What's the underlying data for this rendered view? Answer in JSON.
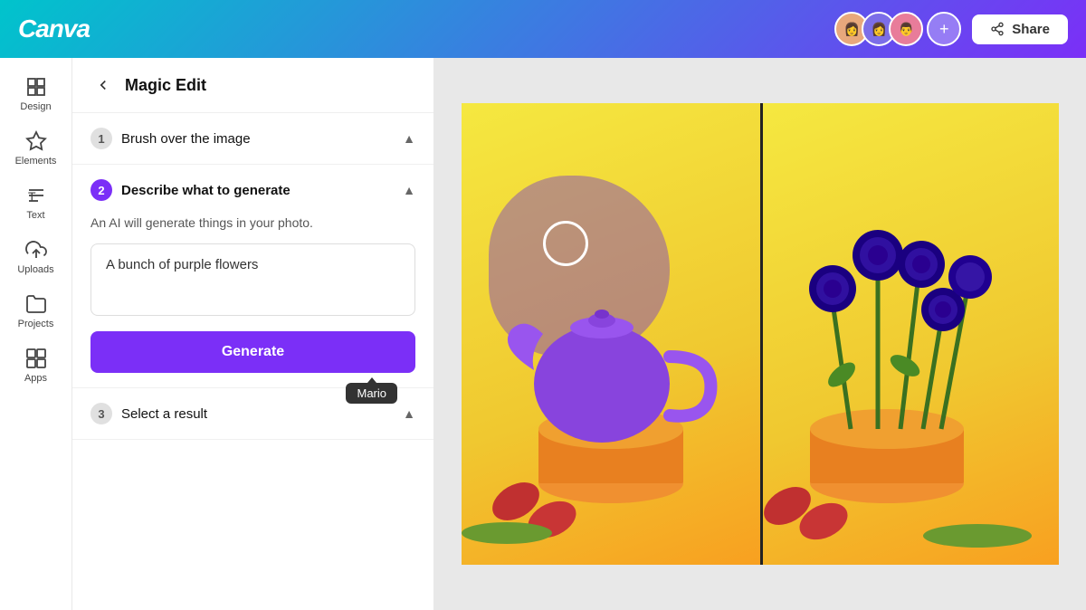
{
  "header": {
    "logo": "Canva",
    "share_label": "Share",
    "add_collaborator_symbol": "+"
  },
  "sidebar": {
    "items": [
      {
        "id": "design",
        "label": "Design",
        "icon": "grid-icon"
      },
      {
        "id": "elements",
        "label": "Elements",
        "icon": "star-icon"
      },
      {
        "id": "text",
        "label": "Text",
        "icon": "text-icon"
      },
      {
        "id": "uploads",
        "label": "Uploads",
        "icon": "upload-icon"
      },
      {
        "id": "projects",
        "label": "Projects",
        "icon": "folder-icon"
      },
      {
        "id": "apps",
        "label": "Apps",
        "icon": "apps-icon"
      }
    ]
  },
  "panel": {
    "back_label": "←",
    "title": "Magic Edit",
    "steps": [
      {
        "number": "1",
        "label": "Brush over the image",
        "active": false,
        "expanded": false
      },
      {
        "number": "2",
        "label": "Describe what to generate",
        "active": true,
        "expanded": true
      },
      {
        "number": "3",
        "label": "Select a result",
        "active": false,
        "expanded": false
      }
    ],
    "step2": {
      "description": "An AI will generate things in your photo.",
      "input_value": "A bunch of purple flowers",
      "input_placeholder": "Describe what to generate",
      "generate_label": "Generate"
    },
    "tooltip": {
      "text": "Mario"
    }
  }
}
